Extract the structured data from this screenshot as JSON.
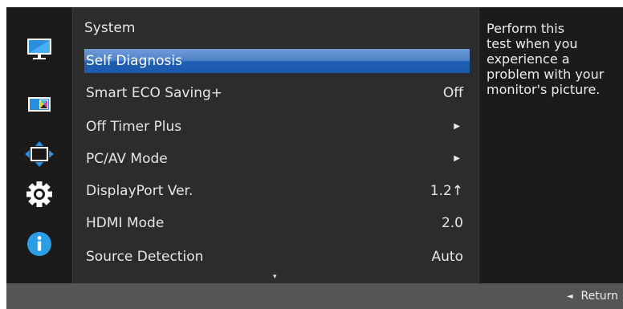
{
  "panel": {
    "title": "System",
    "items": [
      {
        "label": "Self Diagnosis",
        "value": "",
        "has_arrow": false,
        "selected": true
      },
      {
        "label": "Smart ECO Saving+",
        "value": "Off",
        "has_arrow": false,
        "selected": false
      },
      {
        "label": "Off Timer Plus",
        "value": "",
        "has_arrow": true,
        "selected": false
      },
      {
        "label": "PC/AV Mode",
        "value": "",
        "has_arrow": true,
        "selected": false
      },
      {
        "label": "DisplayPort Ver.",
        "value": "1.2↑",
        "has_arrow": false,
        "selected": false
      },
      {
        "label": "HDMI Mode",
        "value": "2.0",
        "has_arrow": false,
        "selected": false
      },
      {
        "label": "Source Detection",
        "value": "Auto",
        "has_arrow": false,
        "selected": false
      }
    ],
    "scroll_indicator": "▾"
  },
  "help_text": {
    "lines": [
      "Perform this",
      "test when you",
      "experience a",
      "problem with your",
      "monitor's picture."
    ]
  },
  "bottom_bar": {
    "return_arrow": "◄",
    "return_label": "Return"
  },
  "sidebar": {
    "icons": [
      "picture-monitor-icon",
      "color-monitor-icon",
      "position-arrows-icon",
      "system-gear-icon",
      "information-icon"
    ]
  },
  "colors": {
    "selection": "#1f5fb3",
    "info_blue": "#2a9fe8",
    "panel_bg": "#2c2c2c",
    "sidebar_bg": "#1b1b1b",
    "bottom_bar_bg": "#555555"
  }
}
